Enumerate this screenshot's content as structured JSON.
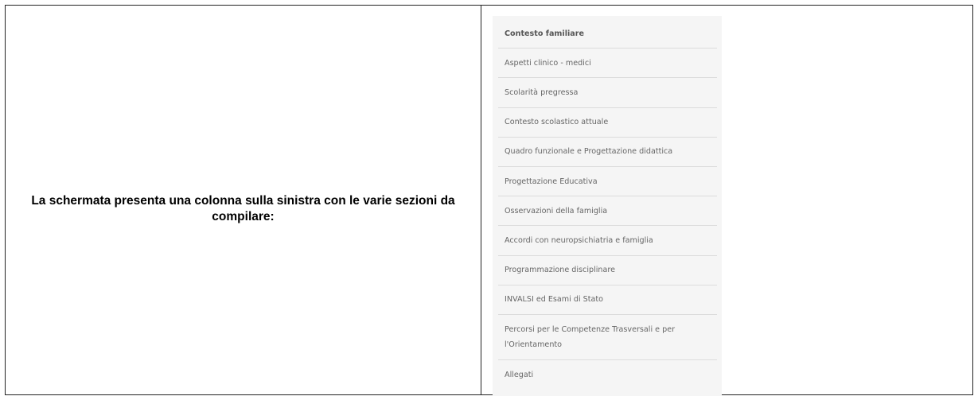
{
  "caption": "La schermata presenta una colonna sulla sinistra con le varie sezioni da compilare:",
  "menu": {
    "items": [
      {
        "label": "Contesto familiare",
        "active": true
      },
      {
        "label": "Aspetti clinico - medici"
      },
      {
        "label": "Scolarità pregressa"
      },
      {
        "label": "Contesto scolastico attuale"
      },
      {
        "label": "Quadro funzionale e Progettazione didattica"
      },
      {
        "label": "Progettazione Educativa"
      },
      {
        "label": "Osservazioni della famiglia"
      },
      {
        "label": "Accordi con neuropsichiatria e famiglia"
      },
      {
        "label": "Programmazione disciplinare"
      },
      {
        "label": "INVALSI ed Esami di Stato"
      },
      {
        "label": "Percorsi per le Competenze Trasversali e per l'Orientamento"
      },
      {
        "label": "Allegati"
      }
    ]
  }
}
